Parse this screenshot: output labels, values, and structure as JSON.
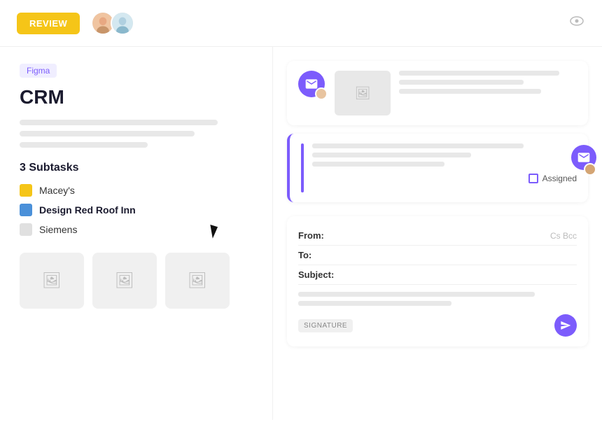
{
  "topbar": {
    "review_label": "REVIEW",
    "eye_icon": "eye-icon"
  },
  "left": {
    "badge": "Figma",
    "title": "CRM",
    "subtasks_title": "3 Subtasks",
    "subtasks": [
      {
        "id": "maceys",
        "label": "Macey's",
        "color": "yellow"
      },
      {
        "id": "design-red-roof",
        "label": "Design Red Roof Inn",
        "color": "blue",
        "active": true
      },
      {
        "id": "siemens",
        "label": "Siemens",
        "color": "gray"
      }
    ]
  },
  "right": {
    "card1": {
      "content_lines": [
        "90",
        "70",
        "80"
      ]
    },
    "card2": {
      "content_lines": [
        "80",
        "60",
        "50"
      ],
      "assigned_label": "Assigned"
    },
    "compose": {
      "from_label": "From:",
      "to_label": "To:",
      "subject_label": "Subject:",
      "cc_label": "Cs Bcc",
      "signature_label": "SIGNATURE"
    }
  }
}
